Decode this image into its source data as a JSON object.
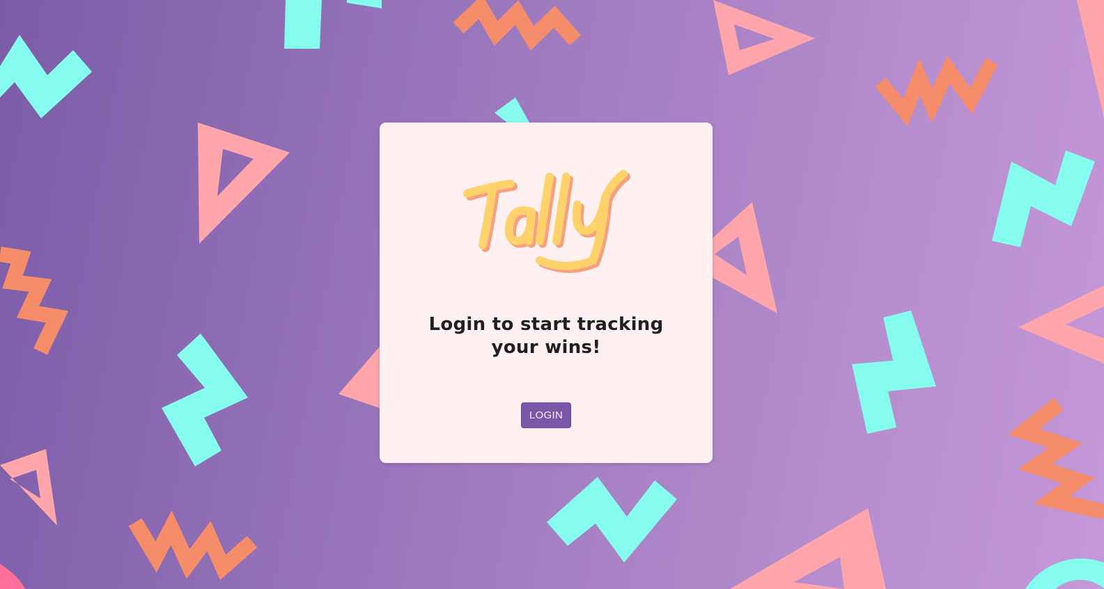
{
  "brand": {
    "logo_text": "Tally",
    "logo_colors": {
      "fill": "#ffd26b",
      "shadow": "#f7a07f"
    }
  },
  "login_card": {
    "headline": "Login to start tracking your wins!",
    "button_label": "LOGIN"
  },
  "theme": {
    "card_background": "#fff1f1",
    "button_color": "#7b57a7",
    "background_gradient": [
      "#7c5ca8",
      "#c598d8"
    ],
    "pattern_colors": {
      "zigzag_orange": "#f58d6b",
      "shape_aqua": "#86fcee",
      "triangle_pink": "#fea6ac"
    }
  },
  "background_pattern": {
    "style": "memphis",
    "shapes": [
      "zigzag",
      "bolt",
      "triangle-outline"
    ]
  }
}
